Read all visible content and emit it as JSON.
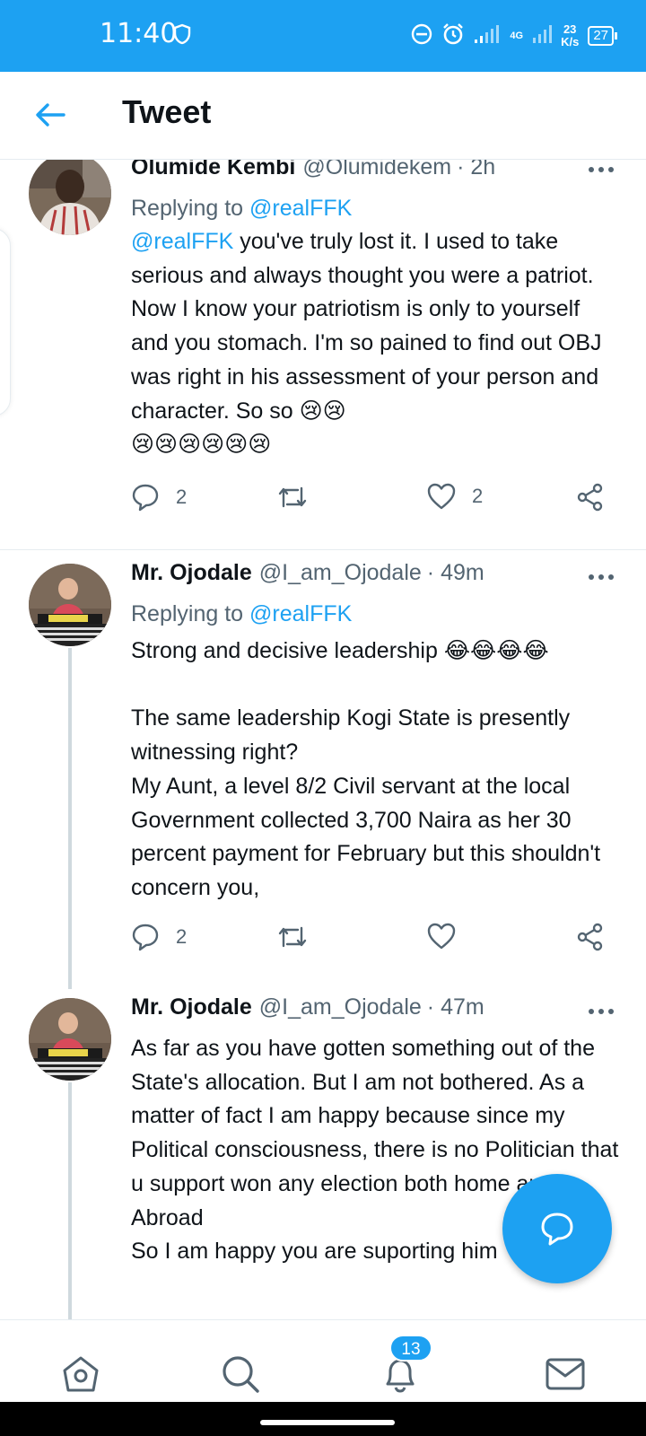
{
  "status_bar": {
    "time": "11:40",
    "net_speed_value": "23",
    "net_speed_unit": "K/s",
    "network_type": "4G",
    "battery": "27"
  },
  "header": {
    "title": "Tweet"
  },
  "tweets": [
    {
      "name": "Olumide Kembi",
      "handle": "@Olumidekem",
      "time": "· 2h",
      "reply_prefix": "Replying to",
      "reply_to": "@realFFK",
      "text_mention": "@realFFK",
      "text": " you've truly lost it. I used to take serious and always thought you were a patriot. Now I know your patriotism is only to yourself and you stomach. I'm so pained to find out OBJ was right in his assessment of your person and character. So so",
      "emoji_trailing": "😢😢",
      "emoji_line": "😢😢😢😢😢😢",
      "replies": "2",
      "likes": "2"
    },
    {
      "name": "Mr. Ojodale",
      "handle": "@I_am_Ojodale",
      "time": "· 49m",
      "reply_prefix": "Replying to",
      "reply_to": "@realFFK",
      "text_line1": "Strong and decisive leadership",
      "emoji_trailing": "😂😂😂😂",
      "text": "The same leadership Kogi State is presently witnessing right?\nMy Aunt, a level 8/2 Civil servant at the local Government collected 3,700 Naira as her 30 percent payment for February but this shouldn't concern you,",
      "replies": "2"
    },
    {
      "name": "Mr. Ojodale",
      "handle": "@I_am_Ojodale",
      "time": "· 47m",
      "text": "As far as you have gotten something out of the State's allocation. But I am not bothered. As a matter of fact I am happy because since my Political consciousness, there is no Politician that  u support won any election both home and Abroad\nSo I am happy you are suporting him"
    }
  ],
  "bottom_nav": {
    "notification_count": "13"
  },
  "colors": {
    "accent": "#1da1f2",
    "secondary_text": "#536471",
    "text": "#0f1419"
  }
}
